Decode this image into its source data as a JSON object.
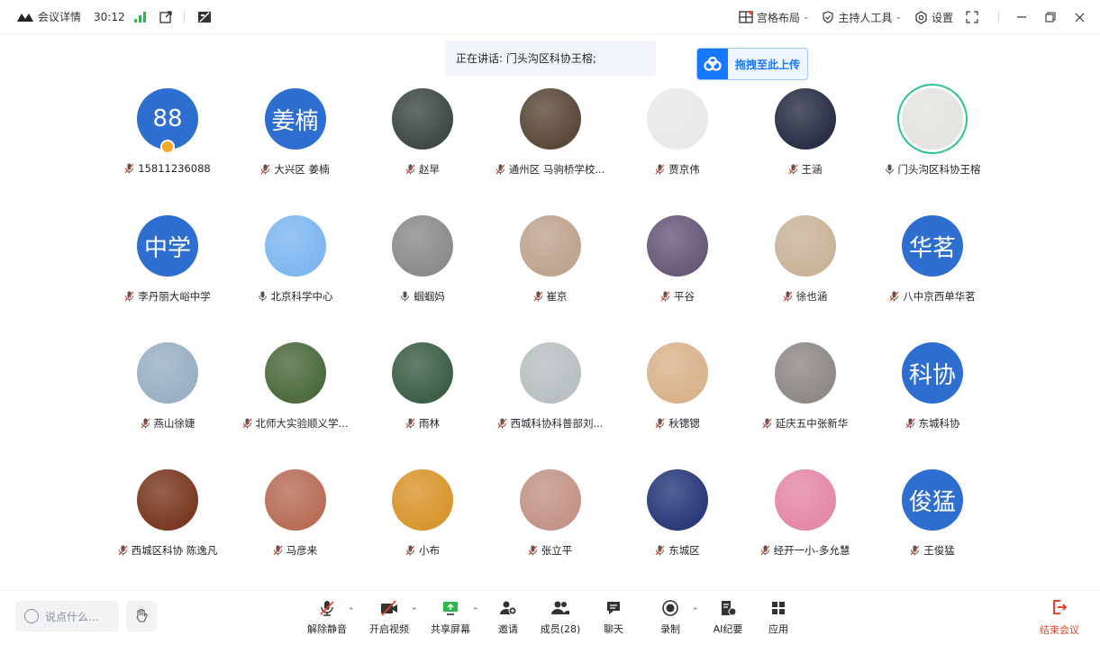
{
  "topbar": {
    "meeting_details": "会议详情",
    "timer": "30:12",
    "layout": "宫格布局",
    "host_tools": "主持人工具",
    "settings": "设置"
  },
  "speaking": {
    "text": "正在讲话: 门头沟区科协王榕;"
  },
  "upload": {
    "label": "拖拽至此上传"
  },
  "participants": [
    {
      "name": "15811236088",
      "avatar_text": "88",
      "muted": true,
      "host": true
    },
    {
      "name": "大兴区 姜楠",
      "avatar_text": "姜楠",
      "muted": true
    },
    {
      "name": "赵早",
      "avatar_text": "",
      "muted": true
    },
    {
      "name": "通州区 马驹桥学校...",
      "avatar_text": "",
      "muted": true
    },
    {
      "name": "贾京伟",
      "avatar_text": "",
      "muted": true
    },
    {
      "name": "王涵",
      "avatar_text": "",
      "muted": true
    },
    {
      "name": "门头沟区科协王榕",
      "avatar_text": "",
      "muted": false,
      "speaking": true
    },
    {
      "name": "李丹丽大峪中学",
      "avatar_text": "中学",
      "muted": true
    },
    {
      "name": "北京科学中心",
      "avatar_text": "",
      "muted": false
    },
    {
      "name": "蝈蝈妈",
      "avatar_text": "",
      "muted": false
    },
    {
      "name": "崔京",
      "avatar_text": "",
      "muted": true
    },
    {
      "name": "平谷",
      "avatar_text": "",
      "muted": true
    },
    {
      "name": "徐也涵",
      "avatar_text": "",
      "muted": true
    },
    {
      "name": "八中京西单华茗",
      "avatar_text": "华茗",
      "muted": true
    },
    {
      "name": "燕山徐婕",
      "avatar_text": "",
      "muted": true
    },
    {
      "name": "北师大实验顺义学...",
      "avatar_text": "",
      "muted": true
    },
    {
      "name": "雨林",
      "avatar_text": "",
      "muted": true
    },
    {
      "name": "西城科协科普部刘...",
      "avatar_text": "",
      "muted": true
    },
    {
      "name": "秋锶锶",
      "avatar_text": "",
      "muted": true
    },
    {
      "name": "延庆五中张新华",
      "avatar_text": "",
      "muted": true
    },
    {
      "name": "东城科协",
      "avatar_text": "科协",
      "muted": true
    },
    {
      "name": "西城区科协 陈逸凡",
      "avatar_text": "",
      "muted": true
    },
    {
      "name": "马彦来",
      "avatar_text": "",
      "muted": true
    },
    {
      "name": "小布",
      "avatar_text": "",
      "muted": true
    },
    {
      "name": "张立平",
      "avatar_text": "",
      "muted": true
    },
    {
      "name": "东城区",
      "avatar_text": "",
      "muted": true
    },
    {
      "name": "经开一小-多允慧",
      "avatar_text": "",
      "muted": true
    },
    {
      "name": "王俊猛",
      "avatar_text": "俊猛",
      "muted": true
    }
  ],
  "avatar_colors": [
    "#2f6ed1",
    "#2f6ed1",
    "#3f4a45",
    "#5b4a3a",
    "#e9e9ea",
    "#2a2f45",
    "#e6e4e1",
    "#2f6ed1",
    "#7fb7f0",
    "#8c8c8c",
    "#bfa490",
    "#6a5a7a",
    "#c9b49a",
    "#2f6ed1",
    "#9ab0c4",
    "#4d6b3e",
    "#3d5f48",
    "#b9c0c2",
    "#d9b38c",
    "#8e8a86",
    "#2f6ed1",
    "#7a3a22",
    "#b86e58",
    "#d8962f",
    "#c39488",
    "#2a3a7a",
    "#e489a8",
    "#2f6ed1"
  ],
  "bottombar": {
    "say_placeholder": "说点什么...",
    "unmute": "解除静音",
    "start_video": "开启视频",
    "share_screen": "共享屏幕",
    "invite": "邀请",
    "members": "成员(28)",
    "chat": "聊天",
    "record": "录制",
    "ai_minutes": "AI纪要",
    "apps": "应用",
    "end_meeting": "结束会议"
  }
}
